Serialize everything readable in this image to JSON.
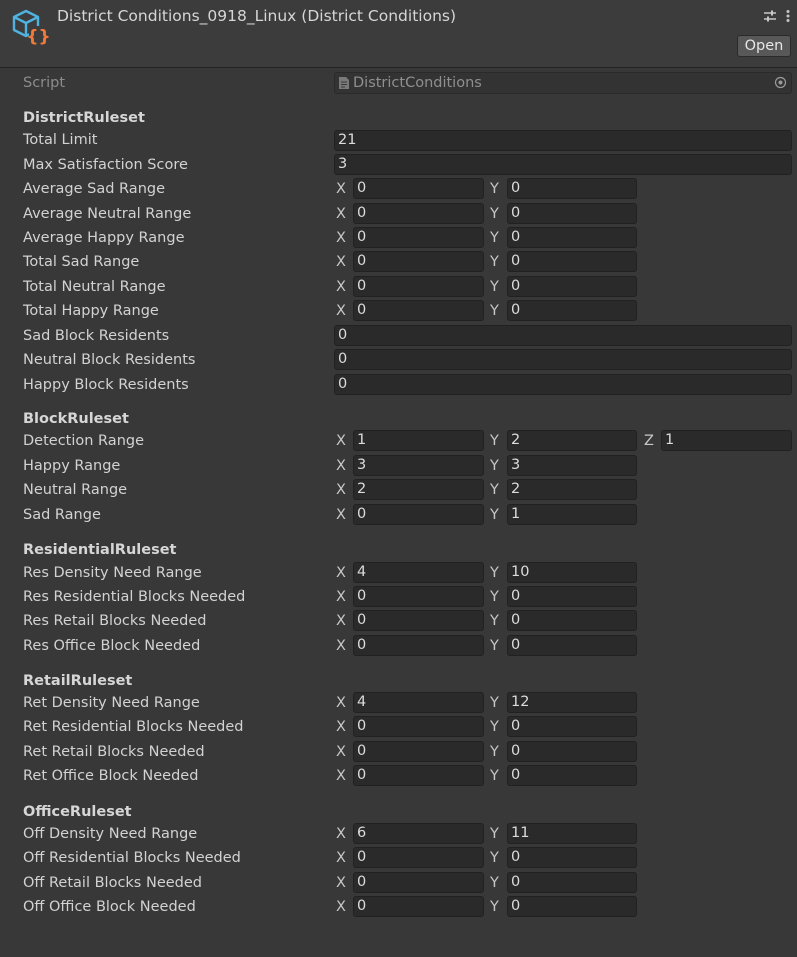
{
  "header": {
    "title": "District Conditions_0918_Linux (District Conditions)",
    "open_label": "Open"
  },
  "script": {
    "label": "Script",
    "value": "DistrictConditions"
  },
  "district": {
    "title": "DistrictRuleset",
    "total_limit": {
      "label": "Total Limit",
      "value": "21"
    },
    "max_satisfaction": {
      "label": "Max Satisfaction Score",
      "value": "3"
    },
    "avg_sad": {
      "label": "Average Sad Range",
      "x": "0",
      "y": "0"
    },
    "avg_neutral": {
      "label": "Average Neutral Range",
      "x": "0",
      "y": "0"
    },
    "avg_happy": {
      "label": "Average Happy Range",
      "x": "0",
      "y": "0"
    },
    "total_sad": {
      "label": "Total Sad Range",
      "x": "0",
      "y": "0"
    },
    "total_neutral": {
      "label": "Total Neutral Range",
      "x": "0",
      "y": "0"
    },
    "total_happy": {
      "label": "Total Happy Range",
      "x": "0",
      "y": "0"
    },
    "sad_block": {
      "label": "Sad Block Residents",
      "value": "0"
    },
    "neutral_block": {
      "label": "Neutral Block Residents",
      "value": "0"
    },
    "happy_block": {
      "label": "Happy Block Residents",
      "value": "0"
    }
  },
  "block": {
    "title": "BlockRuleset",
    "detection": {
      "label": "Detection Range",
      "x": "1",
      "y": "2",
      "z": "1"
    },
    "happy": {
      "label": "Happy Range",
      "x": "3",
      "y": "3"
    },
    "neutral": {
      "label": "Neutral Range",
      "x": "2",
      "y": "2"
    },
    "sad": {
      "label": "Sad Range",
      "x": "0",
      "y": "1"
    }
  },
  "residential": {
    "title": "ResidentialRuleset",
    "density": {
      "label": "Res Density Need Range",
      "x": "4",
      "y": "10"
    },
    "residential": {
      "label": "Res Residential Blocks Needed",
      "x": "0",
      "y": "0"
    },
    "retail": {
      "label": "Res Retail Blocks Needed",
      "x": "0",
      "y": "0"
    },
    "office": {
      "label": "Res Office Block Needed",
      "x": "0",
      "y": "0"
    }
  },
  "retail": {
    "title": "RetailRuleset",
    "density": {
      "label": "Ret Density Need Range",
      "x": "4",
      "y": "12"
    },
    "residential": {
      "label": "Ret Residential Blocks Needed",
      "x": "0",
      "y": "0"
    },
    "retail": {
      "label": "Ret Retail Blocks Needed",
      "x": "0",
      "y": "0"
    },
    "office": {
      "label": "Ret Office Block Needed",
      "x": "0",
      "y": "0"
    }
  },
  "office": {
    "title": "OfficeRuleset",
    "density": {
      "label": "Off Density Need Range",
      "x": "6",
      "y": "11"
    },
    "residential": {
      "label": "Off Residential Blocks Needed",
      "x": "0",
      "y": "0"
    },
    "retail": {
      "label": "Off Retail Blocks Needed",
      "x": "0",
      "y": "0"
    },
    "office": {
      "label": "Off Office Block Needed",
      "x": "0",
      "y": "0"
    }
  },
  "axes": {
    "x": "X",
    "y": "Y",
    "z": "Z"
  }
}
